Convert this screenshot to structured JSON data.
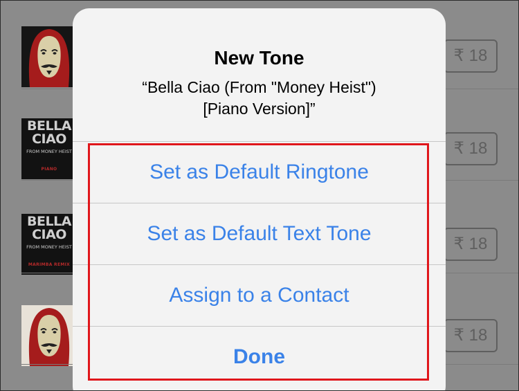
{
  "background_list": {
    "items": [
      {
        "artwork": "mask-art",
        "price": "₹ 18"
      },
      {
        "artwork": "text-art",
        "art_title_line1": "BELLA",
        "art_title_line2": "CIAO",
        "art_subtitle": "FROM MONEY HEIST",
        "art_tag": "PIANO",
        "price": "₹ 18"
      },
      {
        "artwork": "text-art",
        "art_title_line1": "BELLA",
        "art_title_line2": "CIAO",
        "art_subtitle": "FROM MONEY HEIST",
        "art_tag": "MARIMBA REMIX",
        "price": "₹ 18"
      },
      {
        "artwork": "mask-art",
        "price": "₹ 18"
      }
    ]
  },
  "alert": {
    "title": "New Tone",
    "message_line1": "“Bella Ciao (From \"Money Heist\")",
    "message_line2": "[Piano Version]”",
    "actions": [
      {
        "label": "Set as Default Ringtone"
      },
      {
        "label": "Set as Default Text Tone"
      },
      {
        "label": "Assign to a Contact"
      },
      {
        "label": "Done"
      }
    ]
  },
  "colors": {
    "action_blue": "#3a82e8",
    "highlight_red": "#e0161b",
    "dim_overlay": "#8b8b8b"
  }
}
